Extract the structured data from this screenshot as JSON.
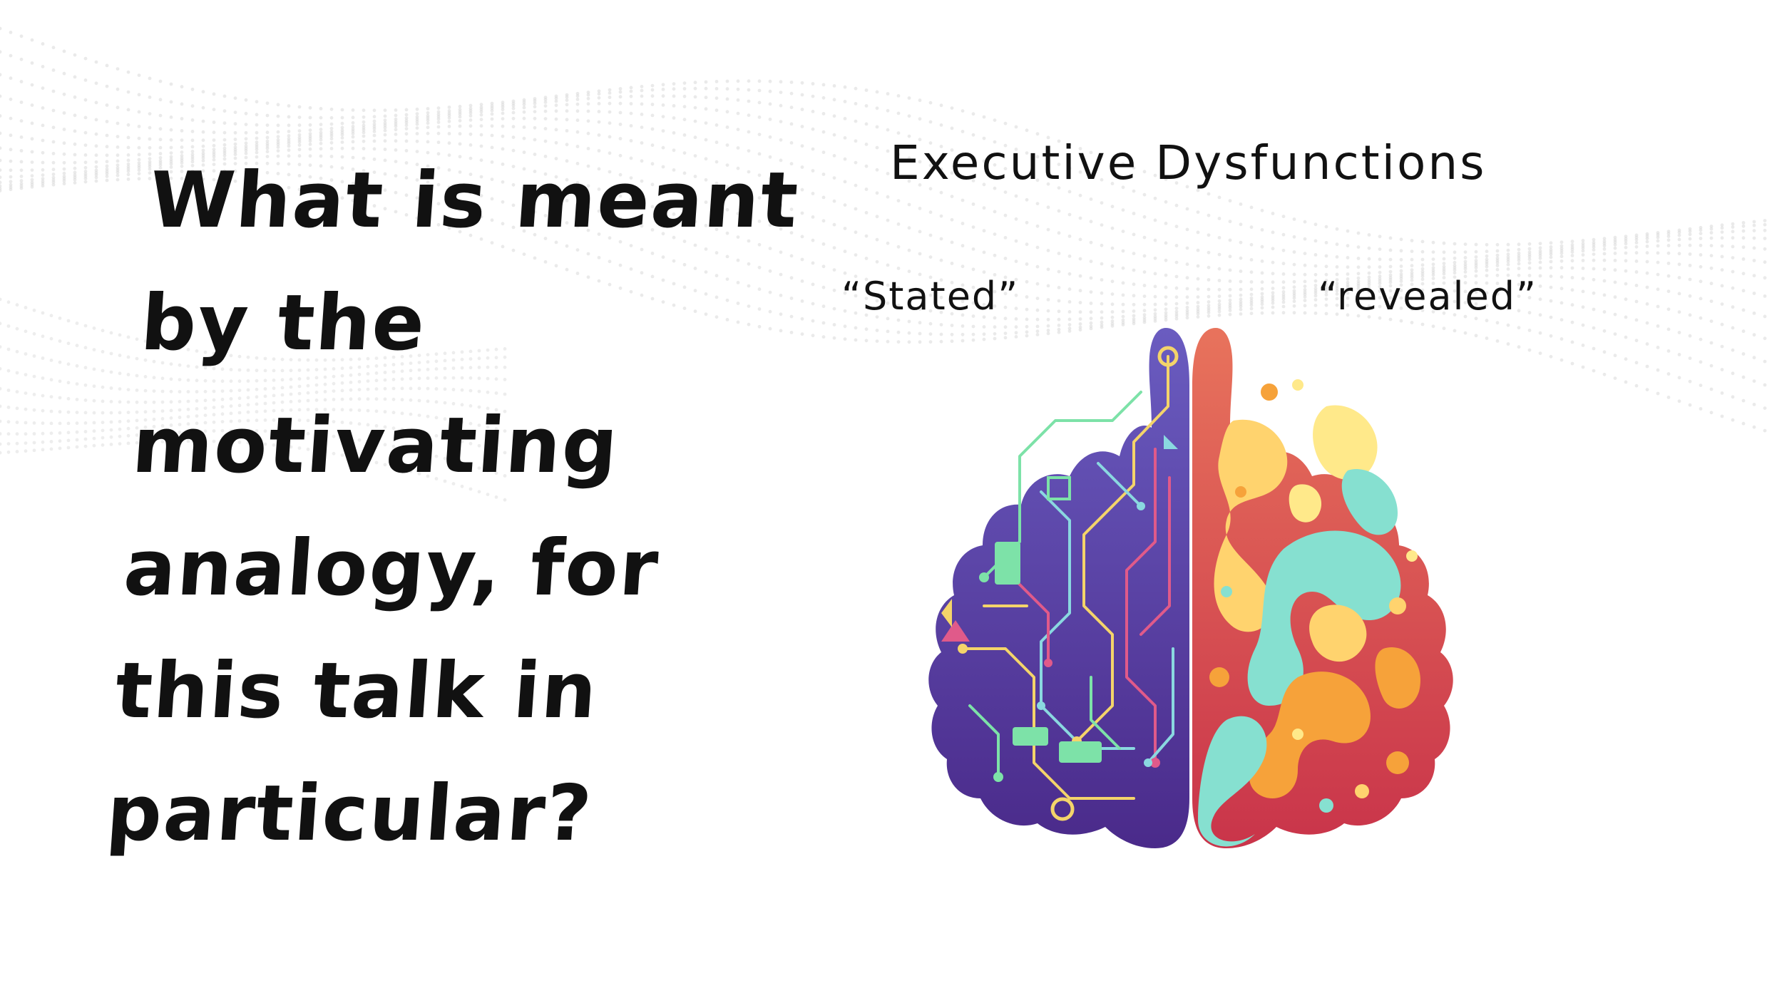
{
  "slide": {
    "title_lines": [
      "What is meant",
      "by the",
      "motivating",
      "analogy, for",
      "this talk in",
      "particular?"
    ]
  },
  "diagram": {
    "heading": "Executive Dysfunctions",
    "left_label": "“Stated”",
    "right_label": "“revealed”",
    "image": "brain-hemispheres-illustration"
  },
  "colors": {
    "text": "#111111",
    "background": "#ffffff",
    "dots": "#d8d8d8",
    "left_hemisphere": [
      "#6a4fb8",
      "#4a2f8c"
    ],
    "circuit_lines": [
      "#f4d46a",
      "#7de2a8",
      "#e05a8a",
      "#8ad8e0"
    ],
    "right_hemisphere": [
      "#e8735c",
      "#c5364a"
    ],
    "right_blobs": [
      "#ffd36e",
      "#f6a23a",
      "#86e0d0",
      "#ffe98a"
    ]
  }
}
